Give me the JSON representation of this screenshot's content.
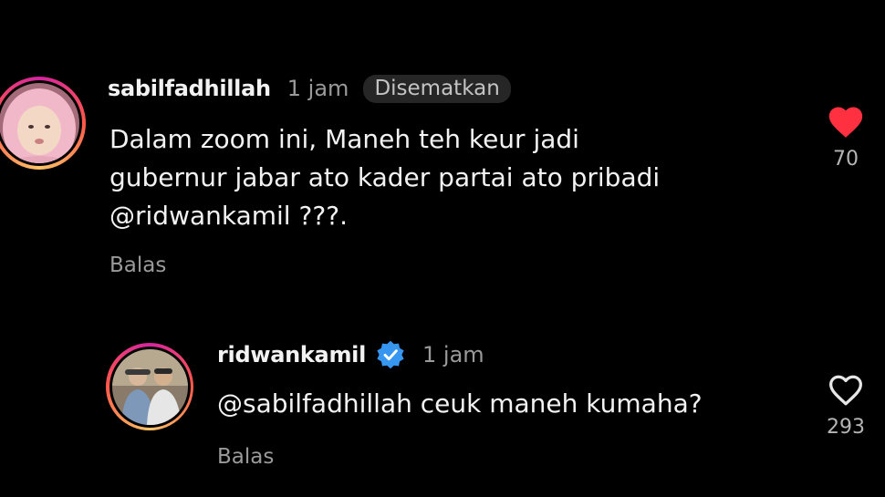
{
  "colors": {
    "background": "#000000",
    "text_primary": "#f2f2f2",
    "text_secondary": "#9a9a9a",
    "like_active": "#ff3040",
    "verified_badge": "#3797f0",
    "pinned_badge_bg": "#262626"
  },
  "comments": [
    {
      "username": "sabilfadhillah",
      "time": "1 jam",
      "pinned_label": "Disematkan",
      "text": "Dalam zoom ini, Maneh teh keur jadi\ngubernur jabar ato kader partai ato pribadi\n@ridwankamil ???.",
      "reply_label": "Balas",
      "likes": "70",
      "liked": true,
      "like_icon": "heart-filled-icon",
      "avatar_icon": "avatar-hijab-girl"
    },
    {
      "username": "ridwankamil",
      "verified": true,
      "verified_icon": "verified-badge-icon",
      "time": "1 jam",
      "text": "@sabilfadhillah ceuk maneh kumaha?",
      "reply_label": "Balas",
      "likes": "293",
      "liked": false,
      "like_icon": "heart-outline-icon",
      "avatar_icon": "avatar-two-men"
    }
  ]
}
